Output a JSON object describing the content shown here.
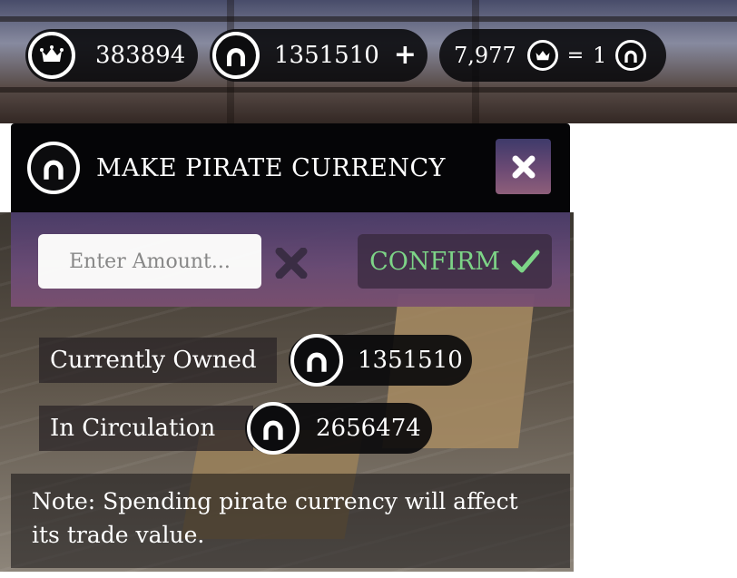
{
  "currency_bar": {
    "crowns_value": "383894",
    "crowns_icon": "crown-icon",
    "doubloons_value": "1351510",
    "doubloons_icon": "pirate-coin-icon",
    "add_icon": "plus-icon",
    "exchange_rate": {
      "crowns_amount": "7,977",
      "equals": "=",
      "pirate_amount": "1"
    }
  },
  "panel": {
    "title": "MAKE PIRATE CURRENCY",
    "title_icon": "pirate-coin-icon",
    "close_icon": "close-icon",
    "amount_input": {
      "placeholder": "Enter Amount...",
      "value": ""
    },
    "clear_icon": "clear-x-icon",
    "confirm_label": "CONFIRM",
    "confirm_icon": "checkmark-icon"
  },
  "stats": {
    "owned_label": "Currently Owned",
    "owned_value": "1351510",
    "circulation_label": "In Circulation",
    "circulation_value": "2656474"
  },
  "note": "Note: Spending pirate currency will affect its trade value.",
  "colors": {
    "confirm_text": "#7fd98a",
    "panel_body": "#5e4670",
    "close_button": "#6c4a74"
  }
}
